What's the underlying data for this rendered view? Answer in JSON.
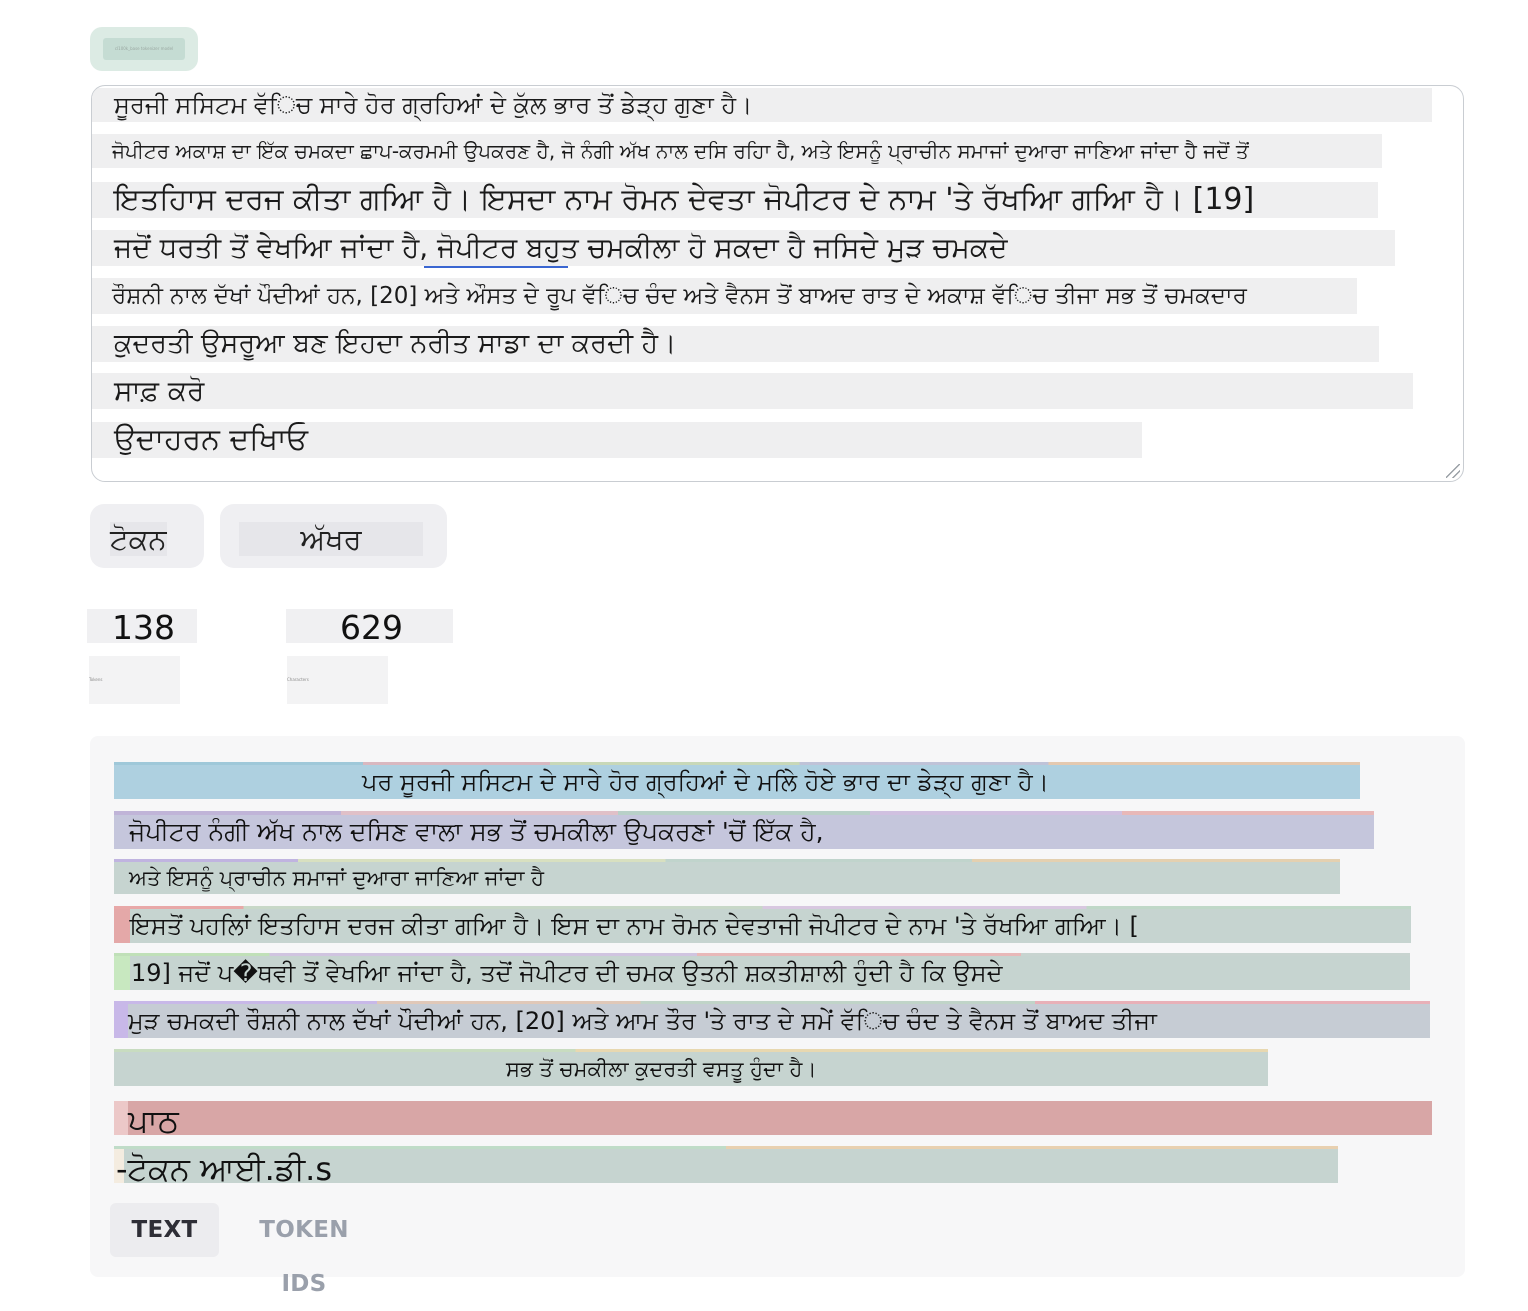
{
  "model_selector": {
    "label": "cl100k_base tokenizer model"
  },
  "editor": {
    "lines": [
      "ਸੂਰਜੀ ਸਸਿਟਮ ਵੱਿਚ ਸਾਰੇ ਹੋਰ ਗ੍ਰਹਿਆਂ ਦੇ ਕੁੱਲ ਭਾਰ ਤੋਂ ਡੇੜ੍ਹ ਗੁਣਾ ਹੈ।",
      "ਜੋਪੀਟਰ ਅਕਾਸ਼ ਦਾ ਇੱਕ ਚਮਕਦਾ ਛਾਪ-ਕਰਮਮੀ ਉਪਕਰਣ ਹੈ, ਜੋ ਨੰਗੀ ਅੱਖ ਨਾਲ ਦਸਿ ਰਹਿਾ ਹੈ, ਅਤੇ ਇਸਨੂੰ ਪ੍ਰਾਚੀਨ ਸਮਾਜਾਂ ਦੁਆਰਾ ਜਾਣਿਆ ਜਾਂਦਾ ਹੈ ਜਦੋਂ ਤੋਂ",
      "ਇਤਹਿਾਸ ਦਰਜ ਕੀਤਾ ਗਆਿ ਹੈ। ਇਸਦਾ ਨਾਮ ਰੋਮਨ ਦੇਵਤਾ ਜੋਪੀਟਰ ਦੇ ਨਾਮ 'ਤੇ ਰੱਖਆਿ ਗਆਿ ਹੈ। [19]",
      "ਜਦੋਂ ਧਰਤੀ ਤੋਂ ਵੇਖਆਿ ਜਾਂਦਾ ਹੈ, ਜੋਪੀਟਰ ਬਹੁਤ ਚਮਕੀਲਾ ਹੋ ਸਕਦਾ ਹੈ ਜਸਿਦੇ ਮੁੜ ਚਮਕਦੇ",
      "ਰੌਸ਼ਨੀ ਨਾਲ ਦੱਖਾਂ ਪੌਦੀਆਂ ਹਨ, [20] ਅਤੇ ਔਸਤ ਦੇ ਰੂਪ ਵੱਿਚ ਚੰਦ ਅਤੇ ਵੈਨਸ ਤੋਂ ਬਾਅਦ ਰਾਤ ਦੇ ਅਕਾਸ਼ ਵੱਿਚ ਤੀਜਾ ਸਭ ਤੋਂ ਚਮਕਦਾਰ",
      "ਕੁਦਰਤੀ ਉਸਰੂਆ ਬਣ ਇਹਦਾ ਨਰੀਤ ਸਾਡਾ ਦਾ ਕਰਦੀ ਹੈ।",
      "ਸਾਫ਼ ਕਰੋ",
      "ਉਦਾਹਰਨ ਦਖਾਿਓ"
    ]
  },
  "toggle": {
    "tokens_label": "ਟੋਕਨ",
    "chars_label": "ਅੱਖਰ"
  },
  "stats": {
    "tokens": {
      "value": "138",
      "label": "Tokens"
    },
    "chars": {
      "value": "629",
      "label": "Characters"
    }
  },
  "output": {
    "segments": [
      "ਪਰ ਸੂਰਜੀ ਸਸਿਟਮ ਦੇ ਸਾਰੇ ਹੋਰ ਗ੍ਰਹਿਆਂ ਦੇ ਮਲਿੇ ਹੋਏ ਭਾਰ ਦਾ ਡੇੜ੍ਹ ਗੁਣਾ ਹੈ।",
      "ਜੋਪੀਟਰ ਨੰਗੀ ਅੱਖ ਨਾਲ ਦਸਿਣ ਵਾਲਾ ਸਭ ਤੋਂ ਚਮਕੀਲਾ ਉਪਕਰਣਾਂ 'ਚੋਂ ਇੱਕ ਹੈ,",
      "ਅਤੇ ਇਸਨੂੰ ਪ੍ਰਾਚੀਨ ਸਮਾਜਾਂ ਦੁਆਰਾ ਜਾਣਿਆ ਜਾਂਦਾ ਹੈ",
      "ਇਸਤੋਂ ਪਹਲਿਾਂ ਇਤਹਿਾਸ ਦਰਜ ਕੀਤਾ ਗਆਿ ਹੈ। ਇਸ ਦਾ ਨਾਮ ਰੋਮਨ ਦੇਵਤਾਜੀ ਜੋਪੀਟਰ ਦੇ ਨਾਮ 'ਤੇ ਰੱਖਆਿ ਗਆਿ। [",
      "19] ਜਦੋਂ ਪ�ਥਵੀ ਤੋਂ ਵੇਖਆਿ ਜਾਂਦਾ ਹੈ, ਤਦੋਂ ਜੋਪੀਟਰ ਦੀ ਚਮਕ ਉਤਨੀ ਸ਼ਕਤੀਸ਼ਾਲੀ ਹੁੰਦੀ ਹੈ ਕਿ ਉਸਦੇ",
      "ਮੁੜ ਚਮਕਦੀ ਰੌਸ਼ਨੀ ਨਾਲ ਦੱਖਾਂ ਪੌਦੀਆਂ ਹਨ, [20] ਅਤੇ ਆਮ ਤੌਰ 'ਤੇ ਰਾਤ ਦੇ ਸਮੇਂ ਵੱਿਚ ਚੰਦ ਤੇ ਵੈਨਸ ਤੋਂ ਬਾਅਦ ਤੀਜਾ",
      "ਸਭ ਤੋਂ ਚਮਕੀਲਾ ਕੁਦਰਤੀ ਵਸਤੂ ਹੁੰਦਾ ਹੈ।",
      "ਪਾਠ",
      "-ਟੋਕਨ ਆਈ.ਡੀ.s"
    ],
    "tabs": {
      "text": "TEXT",
      "token_ids": "TOKEN IDS"
    }
  },
  "colors": {
    "blue": "#aed0e0",
    "lavender": "#c5c6dc",
    "sage": "#c6d4d0",
    "rose": "#d8a6a6",
    "tab_active_bg": "#ececef",
    "tab_inactive_text": "#9aa0ab"
  }
}
